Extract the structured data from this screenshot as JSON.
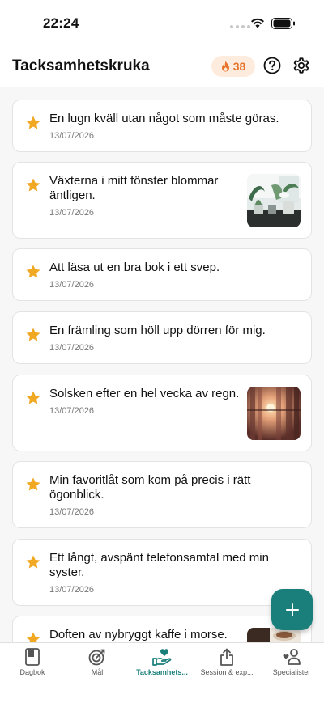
{
  "status": {
    "time": "22:24"
  },
  "header": {
    "title": "Tacksamhetskruka",
    "streak": "38"
  },
  "colors": {
    "accent": "#1a7f7a",
    "star": "#f1a823",
    "streak": "#e8742b",
    "streak_bg": "#fdecde"
  },
  "entries": [
    {
      "text": "En lugn kväll utan något som måste göras.",
      "date": "13/07/2026",
      "thumbnail": null
    },
    {
      "text": "Växterna i mitt fönster blommar äntligen.",
      "date": "13/07/2026",
      "thumbnail": "plants-photo"
    },
    {
      "text": "Att läsa ut en bra bok i ett svep.",
      "date": "13/07/2026",
      "thumbnail": null
    },
    {
      "text": "En främling som höll upp dörren för mig.",
      "date": "13/07/2026",
      "thumbnail": null
    },
    {
      "text": "Solsken efter en hel vecka av regn.",
      "date": "13/07/2026",
      "thumbnail": "sunset-curtains-photo"
    },
    {
      "text": "Min favoritlåt som kom på precis i rätt ögonblick.",
      "date": "13/07/2026",
      "thumbnail": null
    },
    {
      "text": "Ett långt, avspänt telefonsamtal med min syster.",
      "date": "13/07/2026",
      "thumbnail": null
    },
    {
      "text": "Doften av nybryggt kaffe i morse.",
      "date": "",
      "thumbnail": "coffee-photo"
    }
  ],
  "tabs": [
    {
      "label": "Dagbok",
      "icon": "notebook-icon",
      "active": false
    },
    {
      "label": "Mål",
      "icon": "target-icon",
      "active": false
    },
    {
      "label": "Tacksamhets...",
      "icon": "heart-hand-icon",
      "active": true
    },
    {
      "label": "Session & exp...",
      "icon": "share-icon",
      "active": false
    },
    {
      "label": "Specialister",
      "icon": "people-icon",
      "active": false
    }
  ]
}
